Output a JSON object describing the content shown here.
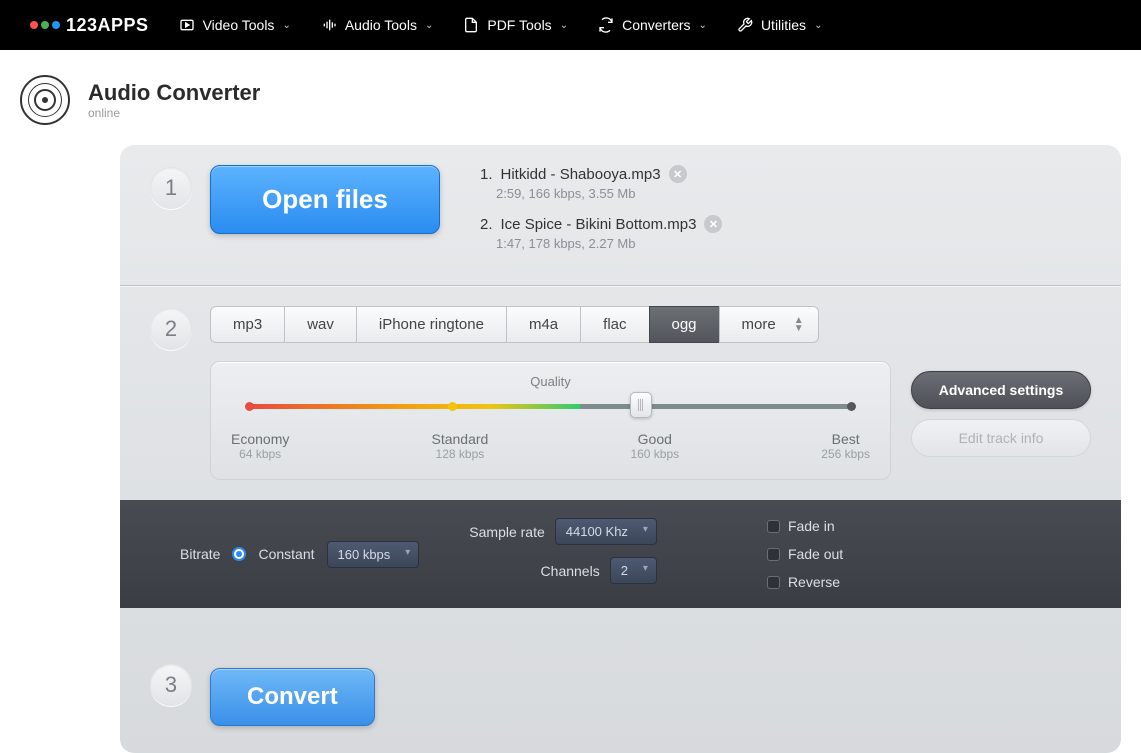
{
  "logo": {
    "text": "123APPS"
  },
  "nav": [
    {
      "label": "Video Tools"
    },
    {
      "label": "Audio Tools"
    },
    {
      "label": "PDF Tools"
    },
    {
      "label": "Converters"
    },
    {
      "label": "Utilities"
    }
  ],
  "header": {
    "title": "Audio Converter",
    "subtitle": "online"
  },
  "step1": {
    "openButton": "Open files",
    "files": [
      {
        "index": "1.",
        "name": "Hitkidd - Shabooya.mp3",
        "meta": "2:59, 166 kbps, 3.55 Mb"
      },
      {
        "index": "2.",
        "name": "Ice Spice - Bikini Bottom.mp3",
        "meta": "1:47, 178 kbps, 2.27 Mb"
      }
    ]
  },
  "step2": {
    "formats": [
      "mp3",
      "wav",
      "iPhone ringtone",
      "m4a",
      "flac",
      "ogg"
    ],
    "more": "more",
    "active": "ogg",
    "quality": {
      "title": "Quality",
      "labels": [
        {
          "name": "Economy",
          "kbps": "64 kbps"
        },
        {
          "name": "Standard",
          "kbps": "128 kbps"
        },
        {
          "name": "Good",
          "kbps": "160 kbps"
        },
        {
          "name": "Best",
          "kbps": "256 kbps"
        }
      ]
    },
    "advancedBtn": "Advanced settings",
    "editTrackBtn": "Edit track info"
  },
  "advanced": {
    "bitrate": {
      "label": "Bitrate",
      "mode": "Constant",
      "value": "160 kbps"
    },
    "sampleRate": {
      "label": "Sample rate",
      "value": "44100 Khz"
    },
    "channels": {
      "label": "Channels",
      "value": "2"
    },
    "fadeIn": "Fade in",
    "fadeOut": "Fade out",
    "reverse": "Reverse"
  },
  "step3": {
    "convertBtn": "Convert"
  }
}
